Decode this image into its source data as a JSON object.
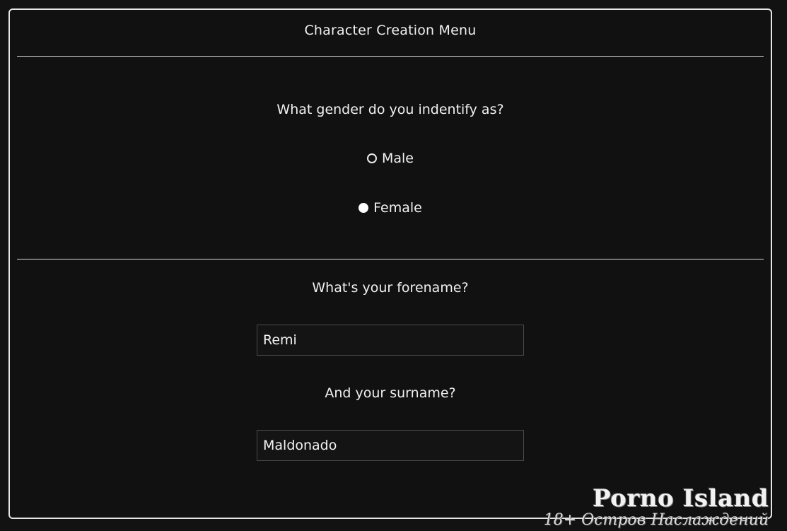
{
  "menu": {
    "title": "Character Creation Menu"
  },
  "gender": {
    "question": "What gender do you indentify as?",
    "options": [
      {
        "label": "Male",
        "selected": false
      },
      {
        "label": "Female",
        "selected": true
      }
    ]
  },
  "forename": {
    "question": "What's your forename?",
    "value": "Remi"
  },
  "surname": {
    "question": "And your surname?",
    "value": "Maldonado"
  },
  "watermark": {
    "line1": "Porno Island",
    "line2": "18+ Остров Наслаждений"
  },
  "colors": {
    "background": "#111111",
    "border": "#e6e6e6",
    "text": "#f0f0f0"
  }
}
